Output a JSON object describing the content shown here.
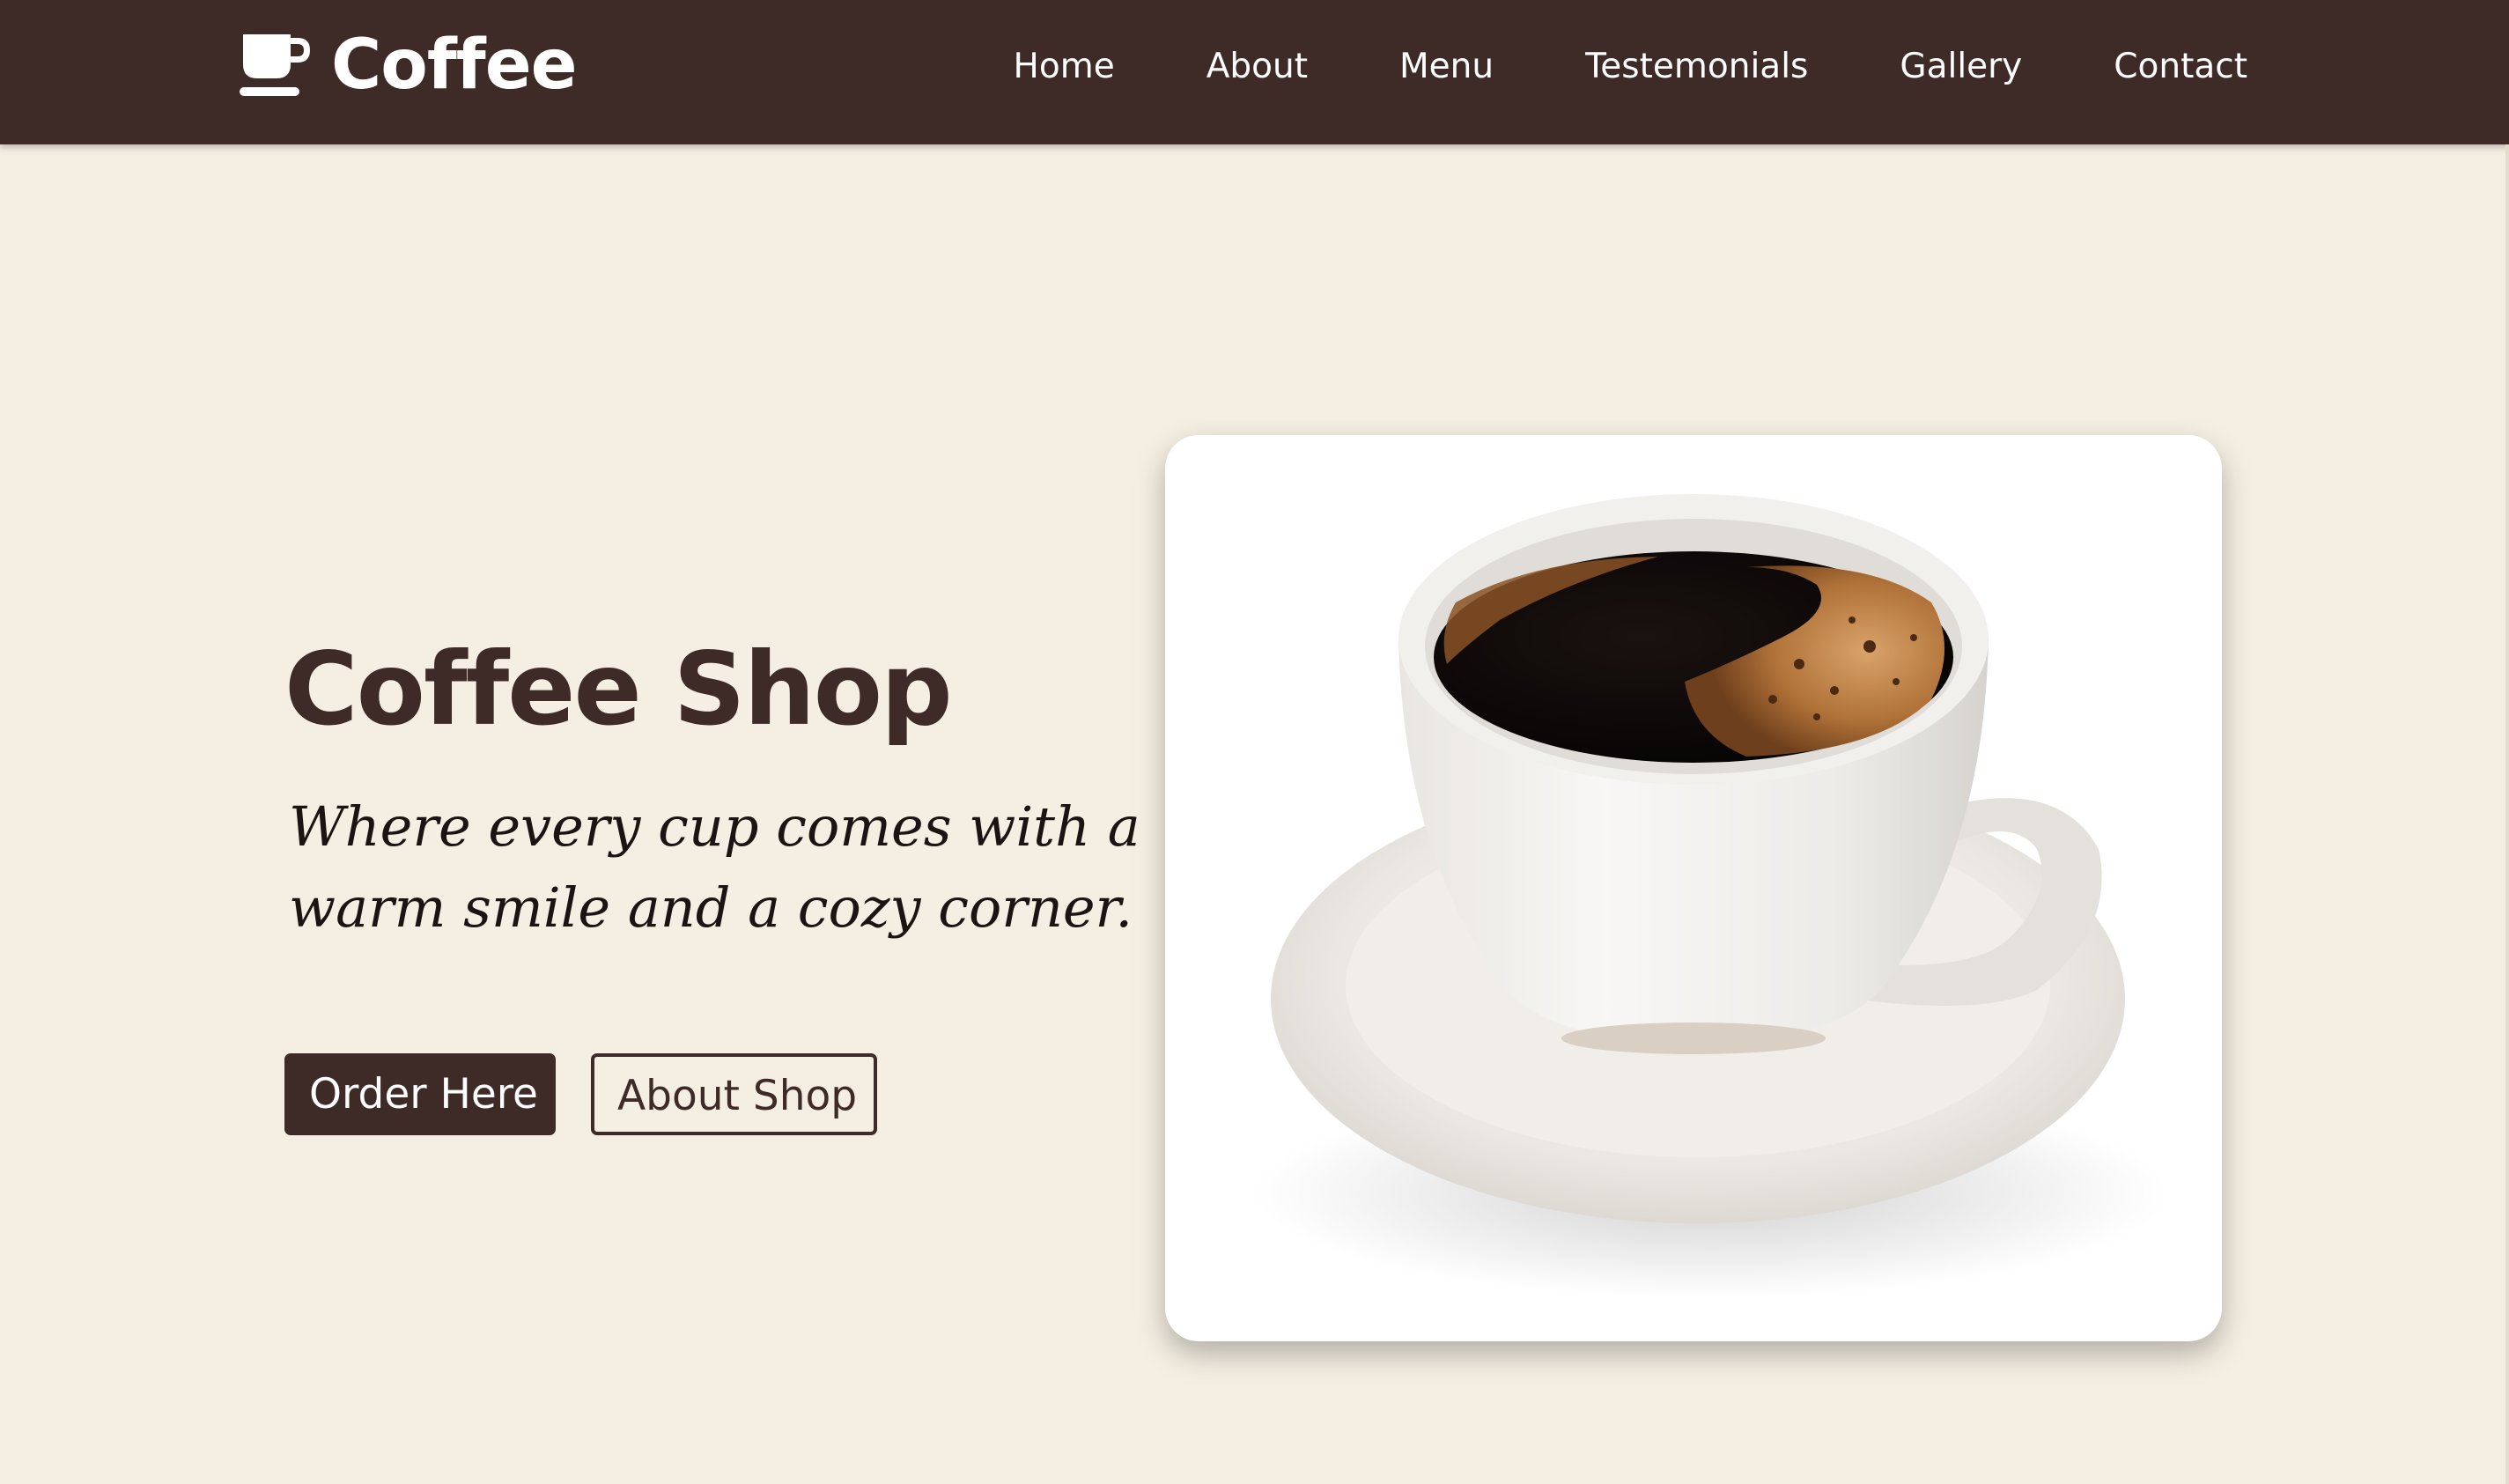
{
  "navbar": {
    "brand_name": "Coffee",
    "brand_icon": "coffee-cup-icon",
    "links": [
      {
        "label": "Home"
      },
      {
        "label": "About"
      },
      {
        "label": "Menu"
      },
      {
        "label": "Testemonials"
      },
      {
        "label": "Gallery"
      },
      {
        "label": "Contact"
      }
    ]
  },
  "hero": {
    "title": "Coffee Shop",
    "tagline": "Where every cup comes with a warm smile and a cozy corner.",
    "order_button": "Order Here",
    "about_button": "About Shop",
    "image_subject": "cup of black coffee on saucer"
  },
  "colors": {
    "nav_background": "#3e2b28",
    "page_background": "#f5efe3",
    "primary_text": "#3e2b28",
    "button_text_light": "#ffffff"
  }
}
